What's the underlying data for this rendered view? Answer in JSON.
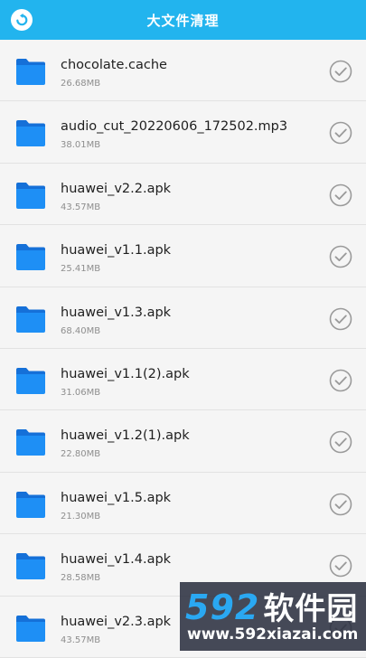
{
  "header": {
    "title": "大文件清理",
    "background_color": "#22b4ee"
  },
  "files": [
    {
      "name": "chocolate.cache",
      "size": "26.68MB"
    },
    {
      "name": "audio_cut_20220606_172502.mp3",
      "size": "38.01MB"
    },
    {
      "name": "huawei_v2.2.apk",
      "size": "43.57MB"
    },
    {
      "name": "huawei_v1.1.apk",
      "size": "25.41MB"
    },
    {
      "name": "huawei_v1.3.apk",
      "size": "68.40MB"
    },
    {
      "name": "huawei_v1.1(2).apk",
      "size": "31.06MB"
    },
    {
      "name": "huawei_v1.2(1).apk",
      "size": "22.80MB"
    },
    {
      "name": "huawei_v1.5.apk",
      "size": "21.30MB"
    },
    {
      "name": "huawei_v1.4.apk",
      "size": "28.58MB"
    },
    {
      "name": "huawei_v2.3.apk",
      "size": "43.57MB"
    }
  ],
  "icons": {
    "back": "back-arrow-icon",
    "file": "folder-icon",
    "select": "check-circle-icon"
  },
  "colors": {
    "folder": "#1e8ff5",
    "check": "#9a9a9a"
  },
  "watermark": {
    "brand_number": "592",
    "brand_text": "软件园",
    "url": "www.592xiazai.com"
  }
}
